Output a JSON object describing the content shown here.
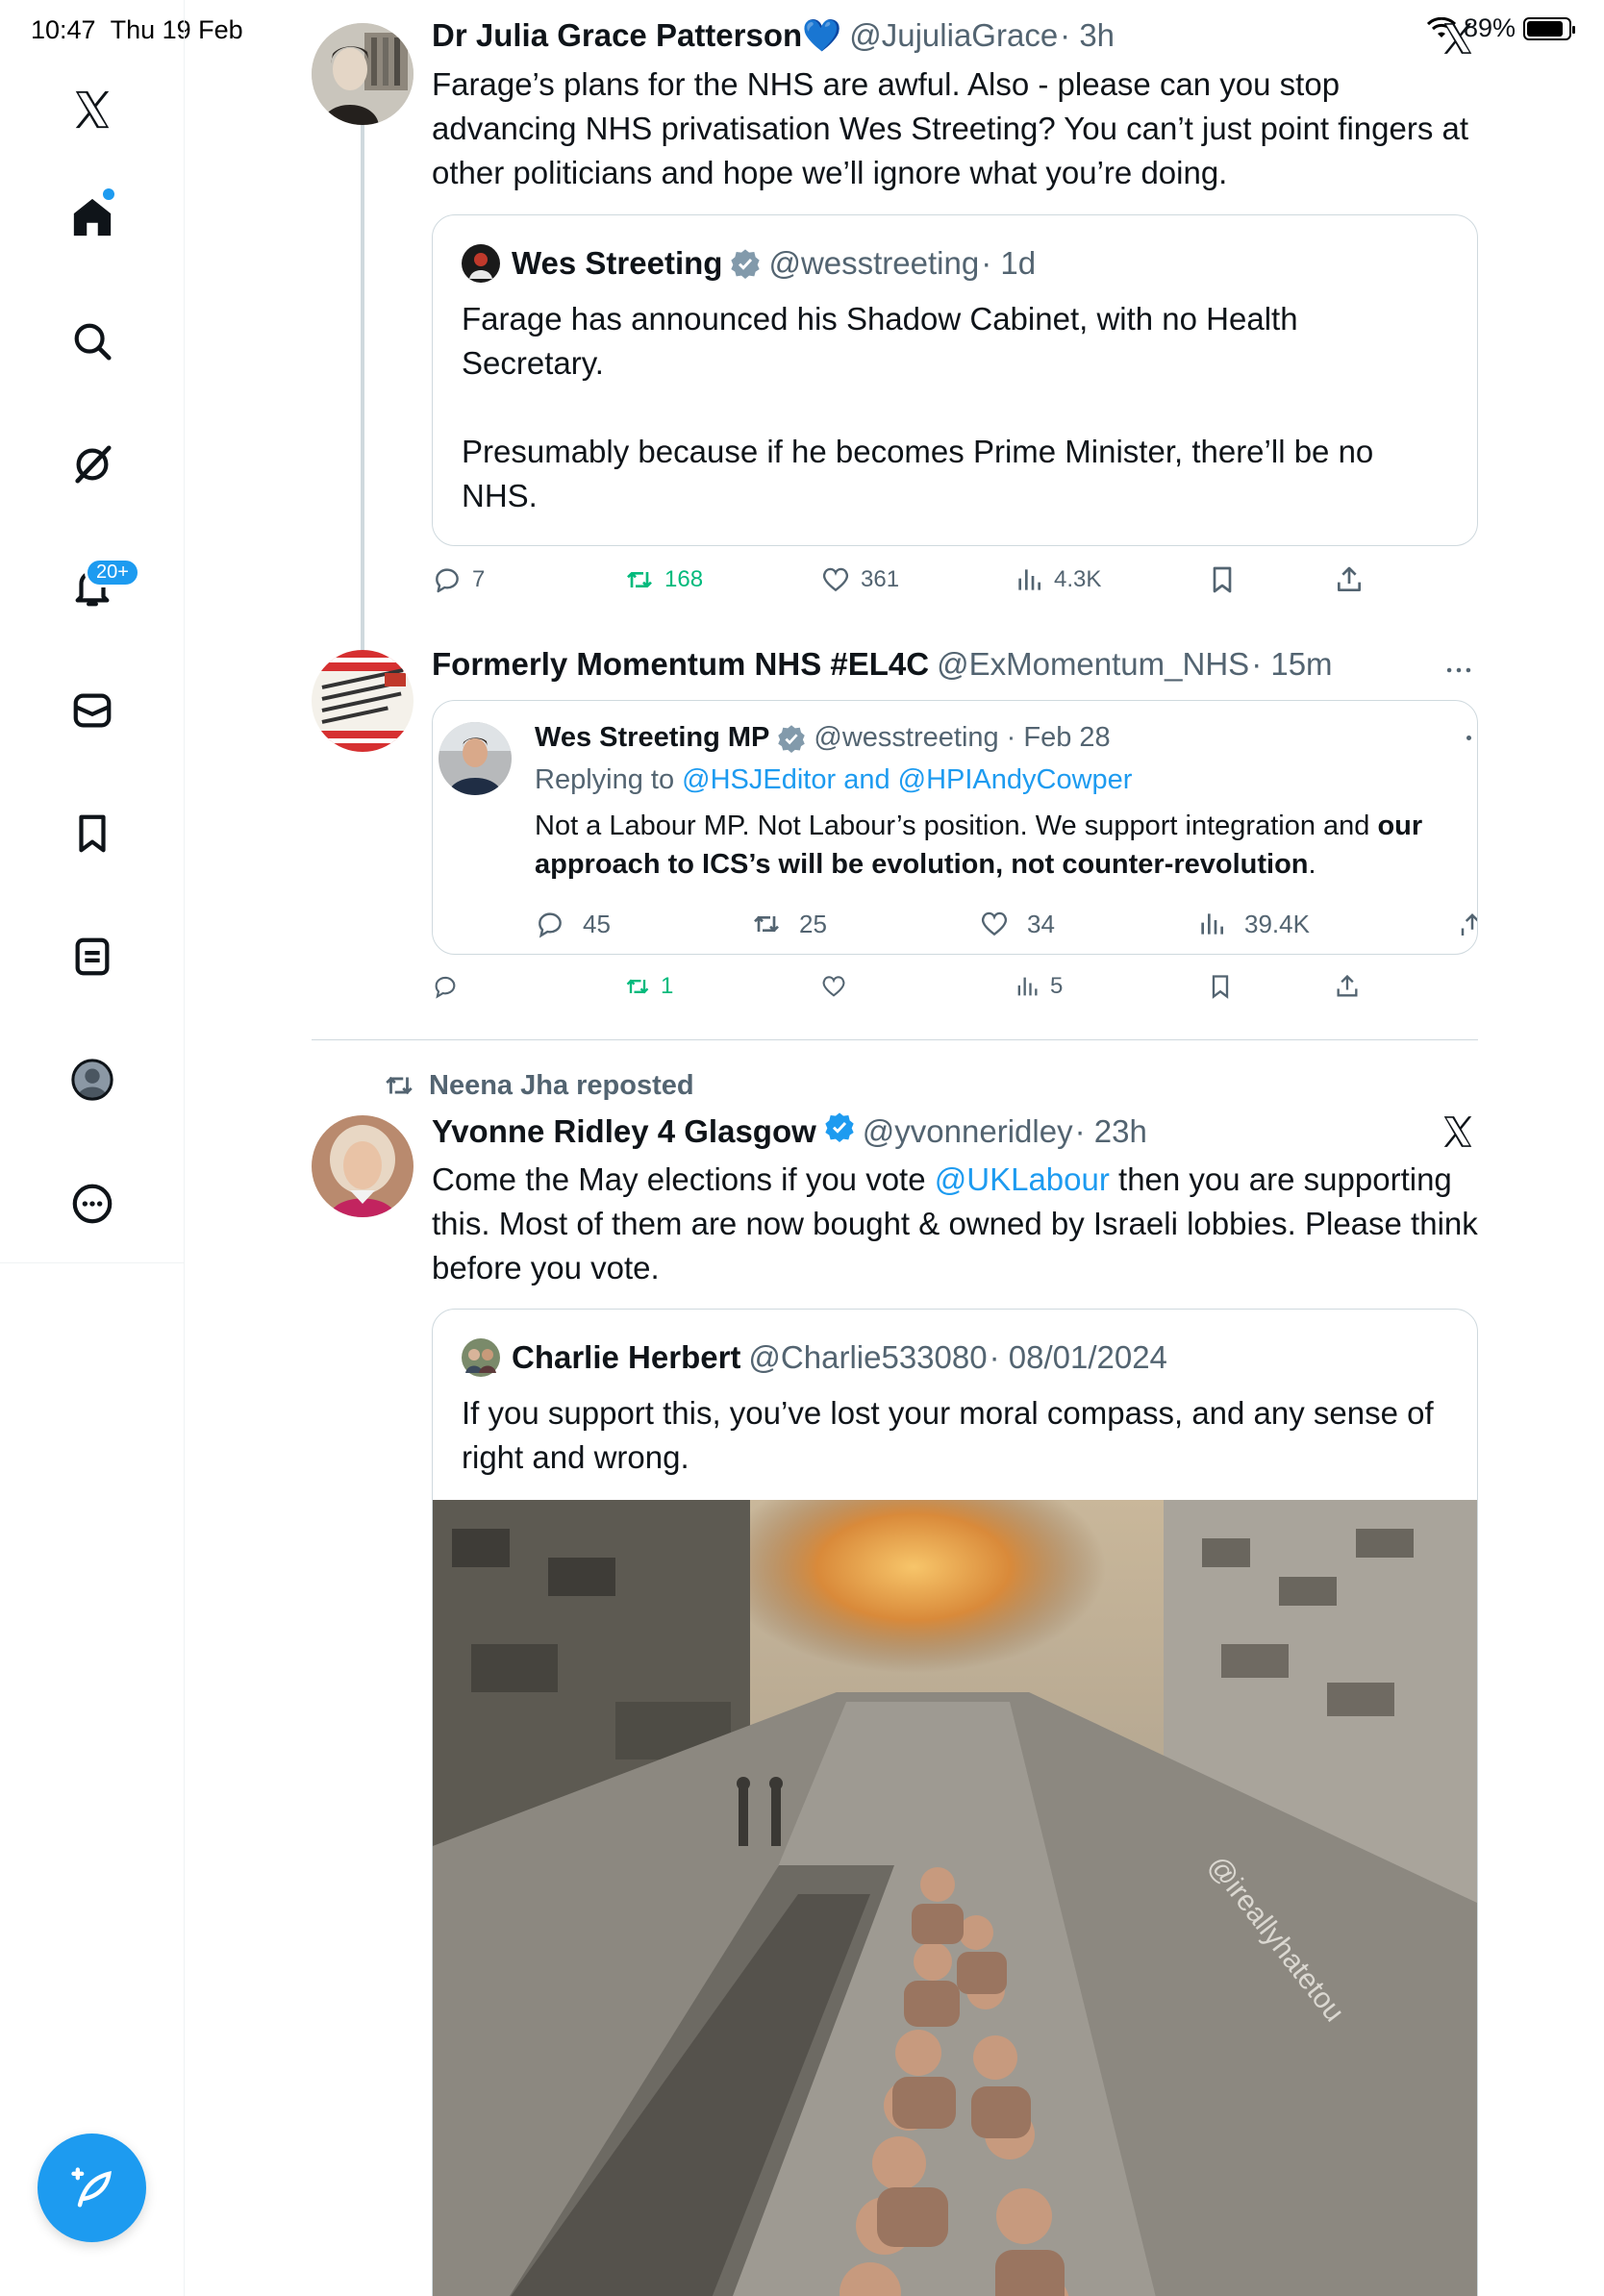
{
  "status_bar": {
    "time": "10:47",
    "date": "Thu 19 Feb",
    "battery": "89%",
    "battery_level": 0.89
  },
  "sidebar": {
    "items": [
      {
        "name": "x-logo-icon"
      },
      {
        "name": "home-icon"
      },
      {
        "name": "search-icon"
      },
      {
        "name": "grok-icon"
      },
      {
        "name": "notifications-icon",
        "badge": "20+"
      },
      {
        "name": "messages-icon"
      },
      {
        "name": "bookmarks-icon"
      },
      {
        "name": "lists-icon"
      },
      {
        "name": "profile-icon"
      },
      {
        "name": "more-icon"
      }
    ],
    "compose_icon": "compose-feather-icon"
  },
  "tweets": [
    {
      "name": "Dr Julia Grace Patterson💙",
      "handle": "@JujuliaGrace",
      "time": "· 3h",
      "text": "Farage’s plans for the NHS are awful. Also - please can you stop advancing NHS privatisation Wes Streeting? You can’t just point fingers at other politicians and hope we’ll ignore what you’re doing.",
      "quote": {
        "name": "Wes Streeting",
        "handle": "@wesstreeting",
        "time": "· 1d",
        "text_p1": "Farage has announced his Shadow Cabinet, with no Health Secretary.",
        "text_p2": "Presumably because if he becomes Prime Minister, there’ll be no NHS."
      },
      "actions": {
        "replies": "7",
        "reposts": "168",
        "likes": "361",
        "views": "4.3K"
      }
    },
    {
      "name": "Formerly Momentum NHS #EL4C",
      "handle": "@ExMomentum_NHS",
      "time": "· 15m",
      "quote": {
        "name": "Wes Streeting MP",
        "handle": "@wesstreeting",
        "time": "· Feb 28",
        "replying_label": "Replying to",
        "replying_targets": "@HSJEditor and @HPIAndyCowper",
        "text_plain": "Not a Labour MP. Not Labour’s position. We support integration and ",
        "text_bold": "our approach to ICS’s will be evolution, not counter-revolution",
        "text_end": ".",
        "stats": {
          "replies": "45",
          "reposts": "25",
          "likes": "34",
          "views": "39.4K"
        }
      },
      "actions": {
        "replies": "",
        "reposts": "1",
        "likes": "",
        "views": "5"
      }
    },
    {
      "repost_label": "Neena Jha reposted",
      "name": "Yvonne Ridley 4 Glasgow",
      "handle": "@yvonneridley",
      "time": "· 23h",
      "text_before": "Come the May elections if you vote ",
      "text_link": "@UKLabour",
      "text_after": " then you are supporting this. Most of them are now bought & owned by Israeli lobbies. Please think before you vote.",
      "quote": {
        "name": "Charlie Herbert",
        "handle": "@Charlie533080",
        "time": "· 08/01/2024",
        "text": "If you support this, you’ve lost your moral compass, and any sense of right and wrong.",
        "media_watermark": "@ireallyhatetou"
      }
    }
  ]
}
